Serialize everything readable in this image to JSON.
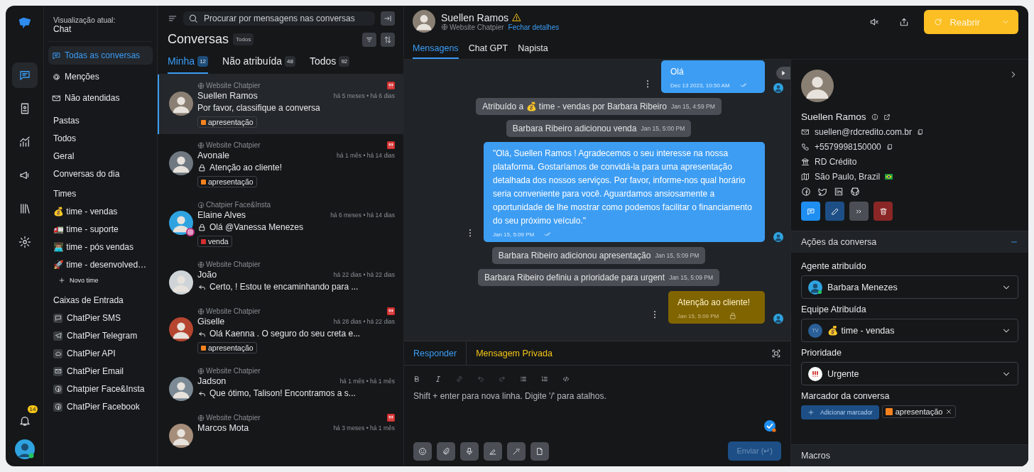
{
  "rail": {
    "items": [
      {
        "kind": "chat",
        "selected": true
      },
      {
        "kind": "contact",
        "selected": false
      },
      {
        "kind": "reports",
        "selected": false
      },
      {
        "kind": "campaign",
        "selected": false
      },
      {
        "kind": "library",
        "selected": false
      },
      {
        "kind": "settings",
        "selected": false
      }
    ],
    "notifications": "14"
  },
  "sidebar": {
    "view_label": "Visualização atual:",
    "view_value": "Chat",
    "items": [
      {
        "kind": "chat",
        "label": "Todas as conversas",
        "selected": true
      },
      {
        "kind": "at",
        "label": "Menções",
        "selected": false
      },
      {
        "kind": "mail",
        "label": "Não atendidas",
        "selected": false
      }
    ],
    "folders_title": "Pastas",
    "folders": [
      "Todos",
      "Geral",
      "Conversas do dia"
    ],
    "teams_title": "Times",
    "teams": [
      "💰 time - vendas",
      "🚛 time - suporte",
      "👨🏽‍💻 time - pós vendas",
      "🚀 time - desenvolved…"
    ],
    "new_team": "Novo time",
    "inboxes_title": "Caixas de Entrada",
    "inboxes": [
      {
        "kind": "sms",
        "label": "ChatPier SMS"
      },
      {
        "kind": "telegram",
        "label": "ChatPier Telegram"
      },
      {
        "kind": "api",
        "label": "ChatPier API"
      },
      {
        "kind": "email",
        "label": "ChatPier Email"
      },
      {
        "kind": "facebook",
        "label": "Chatpier Face&Insta"
      },
      {
        "kind": "facebook",
        "label": "ChatPier Facebook"
      }
    ]
  },
  "conversations": {
    "search": {
      "placeholder": "Procurar por mensagens nas conversas"
    },
    "title": "Conversas",
    "filter_badge": "Todos",
    "tabs": [
      {
        "label": "Minha",
        "count": "12",
        "selected": true
      },
      {
        "label": "Não atribuída",
        "count": "48",
        "selected": false
      },
      {
        "label": "Todos",
        "count": "92",
        "selected": false
      }
    ],
    "items": [
      {
        "inbox": {
          "kind": "web",
          "label": "Website Chatpier"
        },
        "name": "Suellen Ramos",
        "time": "há 5 meses • há 6 dias",
        "preview": {
          "kind": "none",
          "text": "Por favor, classifique a conversa"
        },
        "tag": {
          "label": "apresentação",
          "color": "#f5821f"
        },
        "urgent": true,
        "selected": true,
        "instagram": false
      },
      {
        "inbox": {
          "kind": "web",
          "label": "Website Chatpier"
        },
        "name": "Avonale",
        "time": "há 1 mês • há 14 dias",
        "preview": {
          "kind": "lock",
          "text": "Atenção ao cliente!"
        },
        "tag": {
          "label": "apresentação",
          "color": "#f5821f"
        },
        "urgent": true,
        "selected": false,
        "instagram": false
      },
      {
        "inbox": {
          "kind": "facebook",
          "label": "Chatpier Face&Insta"
        },
        "name": "Elaine Alves",
        "time": "há 6 meses • há 14 dias",
        "preview": {
          "kind": "lock",
          "text": "Olá @Vanessa Menezes"
        },
        "tag": {
          "label": "venda",
          "color": "#d32f2f"
        },
        "urgent": false,
        "selected": false,
        "instagram": true
      },
      {
        "inbox": {
          "kind": "web",
          "label": "Website Chatpier"
        },
        "name": "João",
        "time": "há 22 dias • há 22 dias",
        "preview": {
          "kind": "reply",
          "text": "Certo, ! Estou te encaminhando para ..."
        },
        "urgent": false,
        "selected": false,
        "instagram": false
      },
      {
        "inbox": {
          "kind": "web",
          "label": "Website Chatpier"
        },
        "name": "Giselle",
        "time": "há 28 dias • há 22 dias",
        "preview": {
          "kind": "reply",
          "text": "Olá Kaenna . O seguro do seu creta e..."
        },
        "tag": {
          "label": "apresentação",
          "color": "#f5821f"
        },
        "urgent": true,
        "selected": false,
        "instagram": false
      },
      {
        "inbox": {
          "kind": "web",
          "label": "Website Chatpier"
        },
        "name": "Jadson",
        "time": "há 1 mês • há 1 mês",
        "preview": {
          "kind": "reply",
          "text": "Que ótimo, Talison! Encontramos a s..."
        },
        "urgent": false,
        "selected": false,
        "instagram": false
      },
      {
        "inbox": {
          "kind": "web",
          "label": "Website Chatpier"
        },
        "name": "Marcos Mota",
        "time": "há 3 meses • há 1 mês",
        "urgent": true,
        "selected": false,
        "instagram": false
      }
    ]
  },
  "chat": {
    "name": "Suellen Ramos",
    "inbox": "Website Chatpier",
    "close_details": "Fechar detalhes",
    "reopen": "Reabrir",
    "tabs": [
      {
        "label": "Mensagens",
        "selected": true
      },
      {
        "label": "Chat GPT",
        "selected": false
      },
      {
        "label": "Napista",
        "selected": false
      }
    ],
    "messages": [
      {
        "kind": "outgoing",
        "text": "Olá",
        "time": "Dec 13 2023, 10:50 AM"
      },
      {
        "kind": "activity",
        "text": "Atribuído a 💰 time - vendas por Barbara Ribeiro",
        "time": "Jan 15, 4:59 PM"
      },
      {
        "kind": "activity",
        "text": "Barbara Ribeiro adicionou venda",
        "time": "Jan 15, 5:00 PM"
      },
      {
        "kind": "outgoing",
        "text": "\"Olá, Suellen Ramos ! Agradecemos o seu interesse na nossa plataforma. Gostaríamos de convidá-la para uma apresentação detalhada dos nossos serviços. Por favor, informe-nos qual horário seria conveniente para você. Aguardamos ansiosamente a oportunidade de lhe mostrar como podemos facilitar o financiamento do seu próximo veículo.\"",
        "time": "Jan 15, 5:09 PM"
      },
      {
        "kind": "activity",
        "text": "Barbara Ribeiro adicionou apresentação",
        "time": "Jan 15, 5:09 PM"
      },
      {
        "kind": "activity",
        "text": "Barbara Ribeiro definiu a prioridade para urgent",
        "time": "Jan 15, 5:09 PM"
      },
      {
        "kind": "private",
        "text": "Atenção ao cliente!",
        "time": "Jan 15, 5:09 PM"
      }
    ],
    "composer": {
      "tabs": [
        {
          "label": "Responder",
          "kind": "reply",
          "selected": true
        },
        {
          "label": "Mensagem Privada",
          "kind": "private",
          "selected": false
        }
      ],
      "placeholder": "Shift + enter para nova linha. Digite '/' para atalhos.",
      "send": "Enviar (↵)",
      "send_disabled": true
    }
  },
  "contact": {
    "name": "Suellen Ramos",
    "email": "suellen@rdcredito.com.br",
    "phone": "+5579998150000",
    "company": "RD Crédito",
    "location": "São Paulo, Brazil",
    "actions_title": "Ações da conversa",
    "actions_expanded": true,
    "fields": [
      {
        "label": "Agente atribuído",
        "value": "Barbara Menezes",
        "kind": "agent"
      },
      {
        "label": "Equipe Atribuída",
        "value": "💰 time - vendas",
        "kind": "team",
        "initials": "TV"
      },
      {
        "label": "Prioridade",
        "value": "Urgente",
        "kind": "priority"
      }
    ],
    "labels_title": "Marcador da conversa",
    "add_label": "Adicionar marcador",
    "labels": [
      {
        "label": "apresentação",
        "color": "#f5821f"
      }
    ],
    "macros_title": "Macros"
  }
}
